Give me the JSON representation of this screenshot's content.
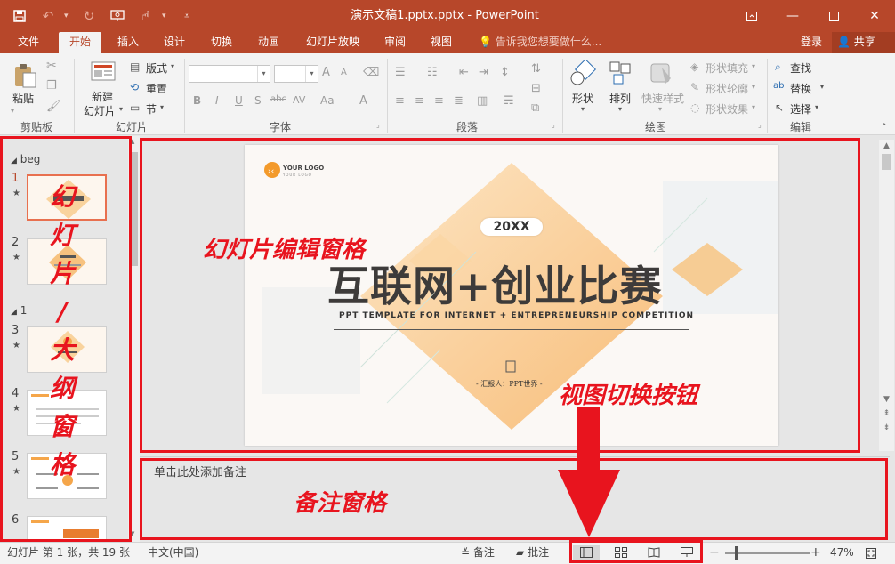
{
  "window": {
    "title": "演示文稿1.pptx.pptx - PowerPoint"
  },
  "quick_access": {
    "icons": [
      "save-icon",
      "undo-icon",
      "redo-icon",
      "present-from-start-icon",
      "touch-mode-icon",
      "customize-qat-icon"
    ]
  },
  "window_controls": {
    "icons": [
      "ribbon-display-options-icon",
      "minimize-icon",
      "maximize-icon",
      "close-icon"
    ]
  },
  "tabs": [
    {
      "label": "文件"
    },
    {
      "label": "开始"
    },
    {
      "label": "插入"
    },
    {
      "label": "设计"
    },
    {
      "label": "切换"
    },
    {
      "label": "动画"
    },
    {
      "label": "幻灯片放映"
    },
    {
      "label": "审阅"
    },
    {
      "label": "视图"
    }
  ],
  "active_tab": "开始",
  "tell_me": "告诉我您想要做什么...",
  "account": {
    "login": "登录",
    "share": "共享"
  },
  "ribbon": {
    "groups": {
      "clipboard": "剪贴板",
      "slides": "幻灯片",
      "font": "字体",
      "paragraph": "段落",
      "drawing": "绘图",
      "editing": "编辑"
    },
    "paste": "粘贴",
    "new_slide_line1": "新建",
    "new_slide_line2": "幻灯片",
    "layout": "版式",
    "reset": "重置",
    "section": "节",
    "shape": "形状",
    "arrange": "排列",
    "quick_styles": "快速样式",
    "shape_fill": "形状填充",
    "shape_outline": "形状轮廓",
    "shape_effects": "形状效果",
    "find": "查找",
    "replace": "替换",
    "select": "选择",
    "font_buttons": {
      "bold": "B",
      "italic": "I",
      "underline": "U",
      "shadow": "S",
      "strikethrough": "abc",
      "spacing": "AV",
      "case": "Aa",
      "grow": "A",
      "shrink": "A",
      "color": "A"
    }
  },
  "thumbnail_pane": {
    "sections": [
      {
        "name": "beg"
      },
      {
        "name": "1"
      }
    ],
    "slides": [
      {
        "number": "1",
        "active": true
      },
      {
        "number": "2",
        "active": false
      },
      {
        "number": "3",
        "active": false
      },
      {
        "number": "4",
        "active": false
      },
      {
        "number": "5",
        "active": false
      },
      {
        "number": "6",
        "active": false
      }
    ]
  },
  "slide": {
    "logo_text": "YOUR LOGO",
    "logo_sub": "YOUR LOGO",
    "badge": "20XX",
    "title": "互联网+创业比赛",
    "subtitle": "PPT TEMPLATE FOR INTERNET + ENTREPRENEURSHIP COMPETITION",
    "reporter": "- 汇报人：PPT世界 -",
    "accent_color": "#f5b467"
  },
  "notes": {
    "placeholder": "单击此处添加备注"
  },
  "status_bar": {
    "slide_info": "幻灯片 第 1 张，共 19 张",
    "language": "中文(中国)",
    "notes": "备注",
    "comments": "批注",
    "zoom": "47%",
    "views": [
      "normal-view-icon",
      "slide-sorter-icon",
      "reading-view-icon",
      "slideshow-icon"
    ]
  },
  "annotations": {
    "thumbnail_pane_chars": [
      "幻",
      "灯",
      "片",
      "/",
      "大",
      "纲",
      "窗",
      "格"
    ],
    "editor": "幻灯片编辑窗格",
    "view_buttons": "视图切换按钮",
    "notes": "备注窗格"
  },
  "colors": {
    "brand": "#b7472a",
    "annotation": "#e8141e"
  }
}
